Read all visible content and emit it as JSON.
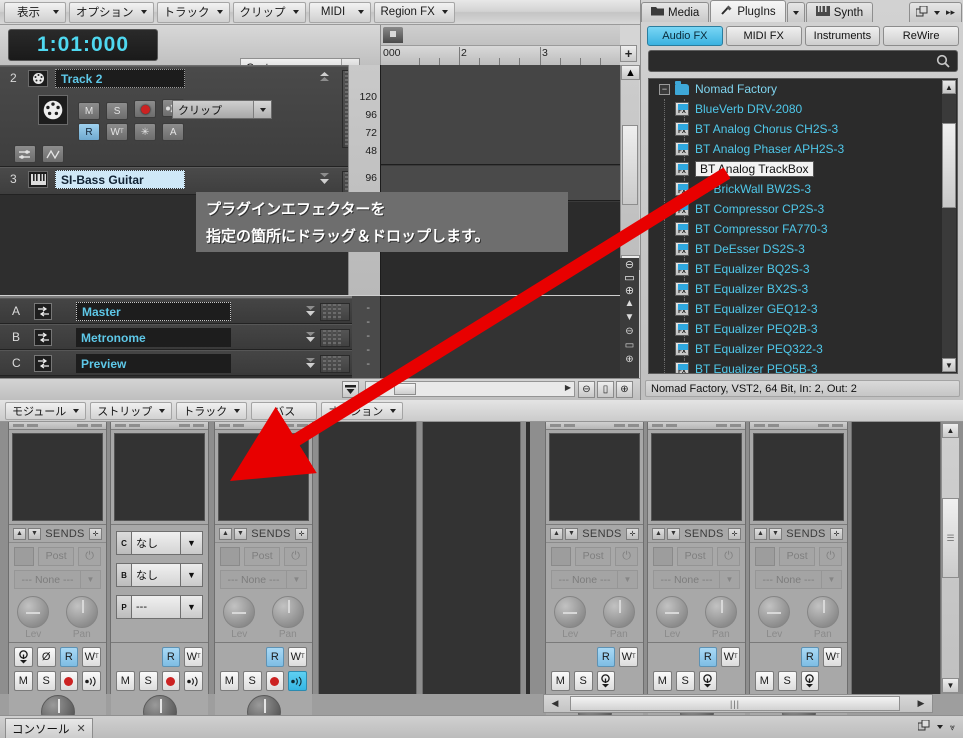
{
  "menubar": {
    "items": [
      {
        "label": "表示",
        "caret": true
      },
      {
        "label": "オプション",
        "caret": true
      },
      {
        "label": "トラック",
        "caret": true
      },
      {
        "label": "クリップ",
        "caret": true
      },
      {
        "label": "MIDI",
        "caret": true
      },
      {
        "label": "Region FX",
        "caret": true
      }
    ]
  },
  "transport": {
    "timecode": "1:01:000",
    "snap_value": "Custom"
  },
  "ruler": {
    "ticks": [
      "000",
      "2",
      "3"
    ],
    "plus_label": "+"
  },
  "tracks": [
    {
      "number": "2",
      "name": "Track 2",
      "icon": "midi-port-icon",
      "clip_combo": "クリップ",
      "buttons_row1": [
        "M",
        "S",
        "rec",
        "input-echo"
      ],
      "buttons_row2": [
        "R",
        "W",
        "*",
        "A"
      ],
      "velocity_scale": [
        "120",
        "96",
        "72",
        "48"
      ]
    },
    {
      "number": "3",
      "name": "SI-Bass Guitar",
      "icon": "keyboard-icon",
      "velocity_scale": [
        "96"
      ]
    }
  ],
  "buses": [
    {
      "letter": "A",
      "name": "Master"
    },
    {
      "letter": "B",
      "name": "Metronome"
    },
    {
      "letter": "C",
      "name": "Preview"
    }
  ],
  "tooltip": {
    "line1": "プラグインエフェクターを",
    "line2": "指定の箇所にドラッグ＆ドロップします。"
  },
  "browser": {
    "tabs": [
      {
        "label": "Media",
        "icon": "folder-icon",
        "active": false
      },
      {
        "label": "PlugIns",
        "icon": "plug-icon",
        "active": true
      },
      {
        "label": "Synth",
        "icon": "keyboard-icon",
        "active": false
      }
    ],
    "tab_caret": "▼",
    "window_icons": [
      "float-icon",
      "caret-down-icon",
      "expand-icon"
    ],
    "filter_buttons": [
      {
        "label": "Audio FX",
        "active": true
      },
      {
        "label": "MIDI FX",
        "active": false
      },
      {
        "label": "Instruments",
        "active": false
      },
      {
        "label": "ReWire",
        "active": false
      }
    ],
    "search_placeholder": "",
    "search_value": "",
    "tree": {
      "root": "Nomad Factory",
      "items": [
        "BlueVerb DRV-2080",
        "BT Analog Chorus CH2S-3",
        "BT Analog Phaser APH2S-3",
        "BT Analog TrackBox",
        "BT BrickWall BW2S-3",
        "BT Compressor CP2S-3",
        "BT Compressor FA770-3",
        "BT DeEsser DS2S-3",
        "BT Equalizer BQ2S-3",
        "BT Equalizer BX2S-3",
        "BT Equalizer GEQ12-3",
        "BT Equalizer PEQ2B-3",
        "BT Equalizer PEQ322-3",
        "BT Equalizer PEQ5B-3"
      ],
      "selected": "BT Analog TrackBox"
    },
    "status": "Nomad Factory, VST2, 64 Bit, In: 2, Out: 2"
  },
  "console": {
    "menus": [
      {
        "label": "モジュール",
        "caret": true
      },
      {
        "label": "ストリップ",
        "caret": true
      },
      {
        "label": "トラック",
        "caret": true
      },
      {
        "label": "バス",
        "caret": false
      },
      {
        "label": "オプション",
        "caret": true
      }
    ],
    "sends_title": "SENDS",
    "post_label": "Post",
    "none_label": "--- None ---",
    "lev_label": "Lev",
    "pan_label": "Pan",
    "bus_sends": [
      {
        "tag": "C",
        "value": "なし"
      },
      {
        "tag": "B",
        "value": "なし"
      },
      {
        "tag": "P",
        "value": "---"
      }
    ],
    "strip_buttons": {
      "mute": "M",
      "solo": "S",
      "record": "rec",
      "input_echo": "input-echo",
      "read": "R",
      "write": "W",
      "phase": "Ø",
      "interleave": "interleave"
    }
  },
  "statusbar": {
    "tab_label": "コンソール",
    "close_glyph": "✕"
  },
  "colors": {
    "accent_cyan": "#4fc8ea",
    "timecode_cyan": "#4fd8f0",
    "arrow_red": "#e80000",
    "active_blue": "#3bb2e0",
    "record_red": "#cc2222"
  }
}
